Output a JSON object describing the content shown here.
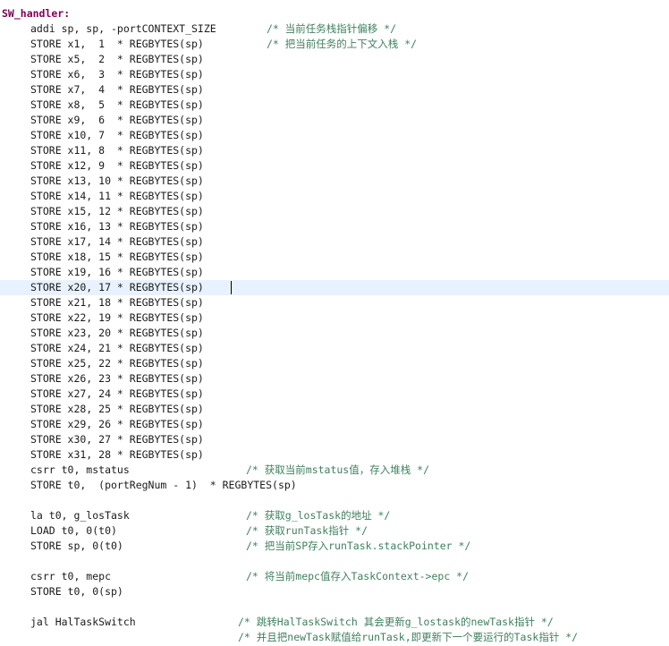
{
  "editor": {
    "label": "SW_handler:",
    "current_line": 18,
    "lines": [
      {
        "code": "addi sp, sp, -portCONTEXT_SIZE",
        "comment": "/* 当前任务栈指针偏移 */"
      },
      {
        "code": "STORE x1,  1  * REGBYTES(sp)",
        "comment": "/* 把当前任务的上下文入栈 */"
      },
      {
        "code": "STORE x5,  2  * REGBYTES(sp)"
      },
      {
        "code": "STORE x6,  3  * REGBYTES(sp)"
      },
      {
        "code": "STORE x7,  4  * REGBYTES(sp)"
      },
      {
        "code": "STORE x8,  5  * REGBYTES(sp)"
      },
      {
        "code": "STORE x9,  6  * REGBYTES(sp)"
      },
      {
        "code": "STORE x10, 7  * REGBYTES(sp)"
      },
      {
        "code": "STORE x11, 8  * REGBYTES(sp)"
      },
      {
        "code": "STORE x12, 9  * REGBYTES(sp)"
      },
      {
        "code": "STORE x13, 10 * REGBYTES(sp)"
      },
      {
        "code": "STORE x14, 11 * REGBYTES(sp)"
      },
      {
        "code": "STORE x15, 12 * REGBYTES(sp)"
      },
      {
        "code": "STORE x16, 13 * REGBYTES(sp)"
      },
      {
        "code": "STORE x17, 14 * REGBYTES(sp)"
      },
      {
        "code": "STORE x18, 15 * REGBYTES(sp)"
      },
      {
        "code": "STORE x19, 16 * REGBYTES(sp)"
      },
      {
        "code": "STORE x20, 17 * REGBYTES(sp)"
      },
      {
        "code": "STORE x21, 18 * REGBYTES(sp)"
      },
      {
        "code": "STORE x22, 19 * REGBYTES(sp)"
      },
      {
        "code": "STORE x23, 20 * REGBYTES(sp)"
      },
      {
        "code": "STORE x24, 21 * REGBYTES(sp)"
      },
      {
        "code": "STORE x25, 22 * REGBYTES(sp)"
      },
      {
        "code": "STORE x26, 23 * REGBYTES(sp)"
      },
      {
        "code": "STORE x27, 24 * REGBYTES(sp)"
      },
      {
        "code": "STORE x28, 25 * REGBYTES(sp)"
      },
      {
        "code": "STORE x29, 26 * REGBYTES(sp)"
      },
      {
        "code": "STORE x30, 27 * REGBYTES(sp)"
      },
      {
        "code": "STORE x31, 28 * REGBYTES(sp)"
      },
      {
        "code": "csrr t0, mstatus",
        "comment": "/* 获取当前mstatus值，存入堆栈 */"
      },
      {
        "code": "STORE t0,  (portRegNum - 1)  * REGBYTES(sp)"
      },
      {
        "code": ""
      },
      {
        "code": "la t0, g_losTask",
        "comment": "/* 获取g_losTask的地址 */"
      },
      {
        "code": "LOAD t0, 0(t0)",
        "comment": "/* 获取runTask指针 */"
      },
      {
        "code": "STORE sp, 0(t0)",
        "comment": "/* 把当前SP存入runTask.stackPointer */"
      },
      {
        "code": ""
      },
      {
        "code": "csrr t0, mepc",
        "comment": "/* 将当前mepc值存入TaskContext->epc */"
      },
      {
        "code": "STORE t0, 0(sp)"
      },
      {
        "code": ""
      },
      {
        "code": "jal HalTaskSwitch",
        "comment": "/* 跳转HalTaskSwitch 其会更新g_lostask的newTask指针 */"
      },
      {
        "code": "",
        "comment": "/* 并且把newTask赋值给runTask,即更新下一个要运行的Task指针 */"
      }
    ]
  }
}
